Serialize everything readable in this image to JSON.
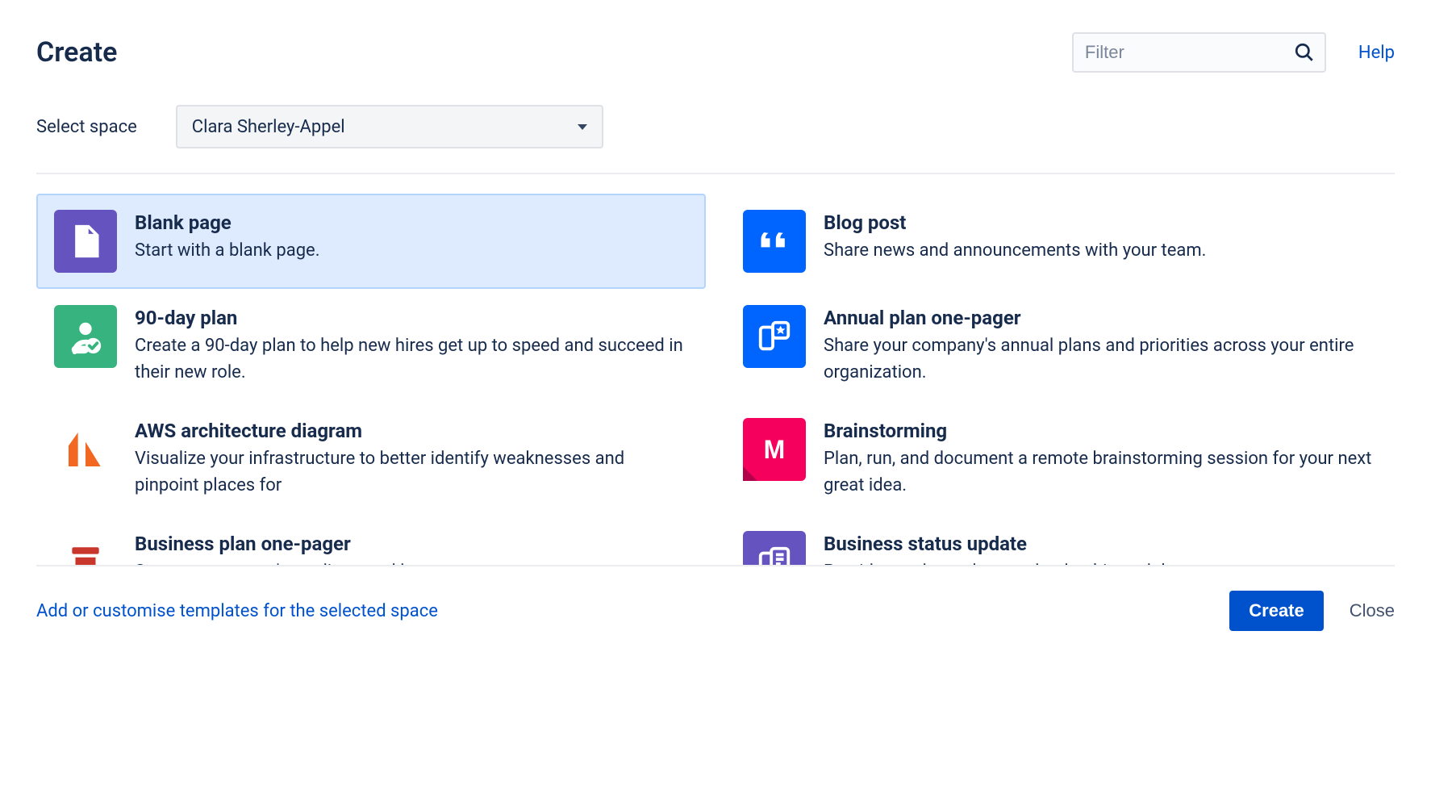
{
  "header": {
    "title": "Create",
    "filter_placeholder": "Filter",
    "help_label": "Help"
  },
  "select_space": {
    "label": "Select space",
    "value": "Clara Sherley-Appel"
  },
  "templates": [
    {
      "id": "blank-page",
      "title": "Blank page",
      "desc": "Start with a blank page.",
      "icon": "page-icon",
      "bg": "#6554C0",
      "selected": true
    },
    {
      "id": "blog-post",
      "title": "Blog post",
      "desc": "Share news and announcements with your team.",
      "icon": "quote-icon",
      "bg": "#0065FF",
      "selected": false
    },
    {
      "id": "90-day-plan",
      "title": "90-day plan",
      "desc": "Create a 90-day plan to help new hires get up to speed and succeed in their new role.",
      "icon": "person-check-icon",
      "bg": "#36B37E",
      "selected": false
    },
    {
      "id": "annual-plan",
      "title": "Annual plan one-pager",
      "desc": "Share your company's annual plans and priorities across your entire organization.",
      "icon": "star-box-icon",
      "bg": "#0065FF",
      "selected": false
    },
    {
      "id": "aws-diagram",
      "title": "AWS architecture diagram",
      "desc": "Visualize your infrastructure to better identify weaknesses and pinpoint places for",
      "icon": "lucid-icon",
      "bg": "#FFFFFF",
      "selected": false
    },
    {
      "id": "brainstorming",
      "title": "Brainstorming",
      "desc": "Plan, run, and document a remote brainstorming session for your next great idea.",
      "icon": "m-icon",
      "bg": "#E6005C",
      "selected": false
    },
    {
      "id": "business-plan",
      "title": "Business plan one-pager",
      "desc": "Set your company's medium- and long-term",
      "icon": "bookmark-icon",
      "bg": "#FFFFFF",
      "selected": false
    },
    {
      "id": "business-status",
      "title": "Business status update",
      "desc": "Provide regular updates to leadership and the",
      "icon": "doc-icon",
      "bg": "#6554C0",
      "selected": false
    }
  ],
  "footer": {
    "customise_label": "Add or customise templates for the selected space",
    "create_label": "Create",
    "close_label": "Close"
  }
}
